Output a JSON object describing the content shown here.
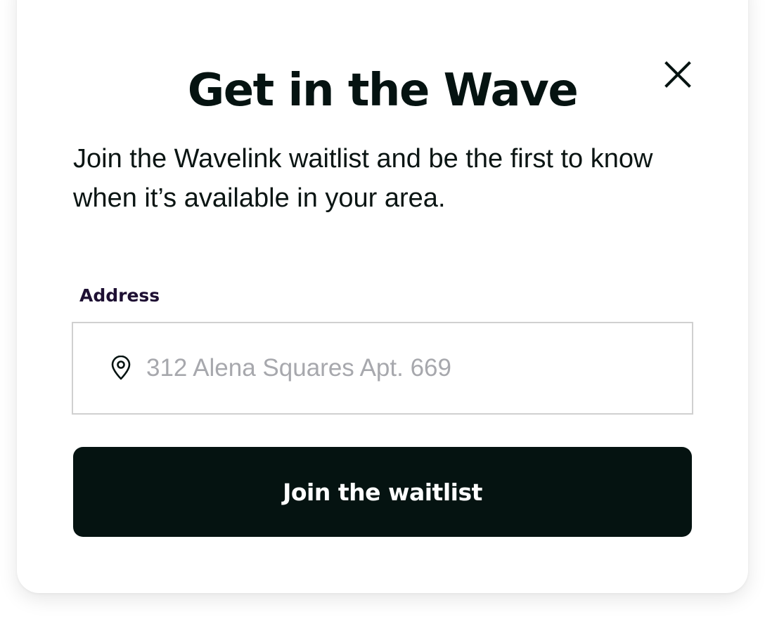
{
  "modal": {
    "title": "Get in the Wave",
    "close_icon": "close-icon",
    "description": "Join the Wavelink waitlist and be the first to know when it’s available in your area.",
    "address": {
      "label": "Address",
      "placeholder": "312 Alena Squares Apt. 669",
      "value": "",
      "icon": "location-pin-icon"
    },
    "submit_label": "Join the waitlist"
  },
  "colors": {
    "primary": "#051311",
    "label": "#1e1033",
    "placeholder": "#a7a8ad",
    "input_border": "#d0d0d0",
    "background": "#ffffff"
  }
}
